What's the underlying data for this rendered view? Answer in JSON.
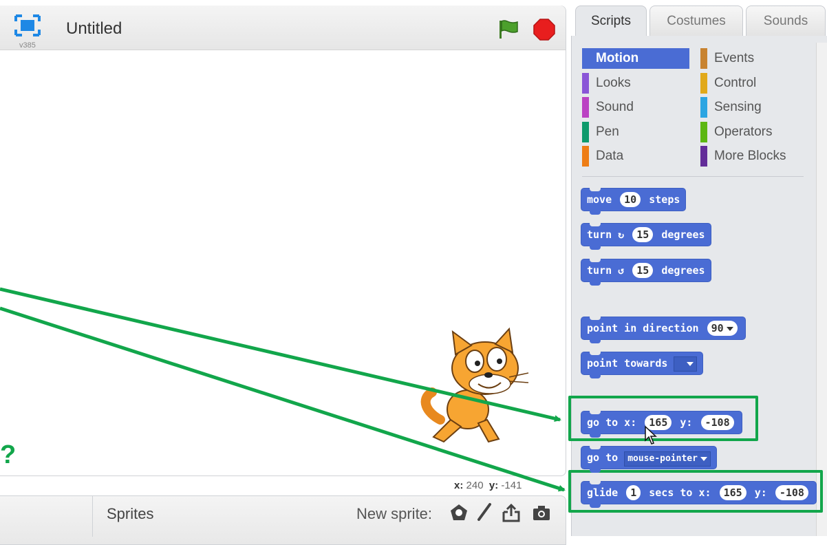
{
  "stage": {
    "title": "Untitled",
    "version": "v385",
    "coords": {
      "x_label": "x:",
      "x_value": "240",
      "y_label": "y:",
      "y_value": "-141"
    }
  },
  "sprites": {
    "label": "Sprites",
    "new_sprite_label": "New sprite:"
  },
  "tabs": [
    "Scripts",
    "Costumes",
    "Sounds"
  ],
  "categories": [
    {
      "label": "Motion",
      "color": "#4a6cd4",
      "selected": true
    },
    {
      "label": "Events",
      "color": "#c88330"
    },
    {
      "label": "Looks",
      "color": "#8a55d7"
    },
    {
      "label": "Control",
      "color": "#e1a91a"
    },
    {
      "label": "Sound",
      "color": "#bb42c3"
    },
    {
      "label": "Sensing",
      "color": "#2ca5e2"
    },
    {
      "label": "Pen",
      "color": "#0e9a6c"
    },
    {
      "label": "Operators",
      "color": "#5cb712"
    },
    {
      "label": "Data",
      "color": "#ee7d16"
    },
    {
      "label": "More Blocks",
      "color": "#632d99"
    }
  ],
  "blocks": {
    "move": {
      "prefix": "move",
      "value": "10",
      "suffix": "steps"
    },
    "turn_right": {
      "prefix": "turn",
      "value": "15",
      "suffix": "degrees"
    },
    "turn_left": {
      "prefix": "turn",
      "value": "15",
      "suffix": "degrees"
    },
    "point_direction": {
      "prefix": "point in direction",
      "value": "90"
    },
    "point_towards": {
      "prefix": "point towards"
    },
    "go_to_xy": {
      "prefix": "go to x:",
      "x": "165",
      "y_label": "y:",
      "y": "-108"
    },
    "go_to": {
      "prefix": "go to",
      "option": "mouse-pointer"
    },
    "glide": {
      "prefix": "glide",
      "secs": "1",
      "middle": "secs to x:",
      "x": "165",
      "y_label": "y:",
      "y": "-108"
    }
  },
  "annotation": {
    "color": "#12a64b",
    "partial_char": "?"
  },
  "icons": [
    "fullscreen-icon",
    "green-flag-icon",
    "stop-icon",
    "sprite-library-icon",
    "paint-icon",
    "upload-icon",
    "camera-icon",
    "mouse-cursor-icon"
  ]
}
